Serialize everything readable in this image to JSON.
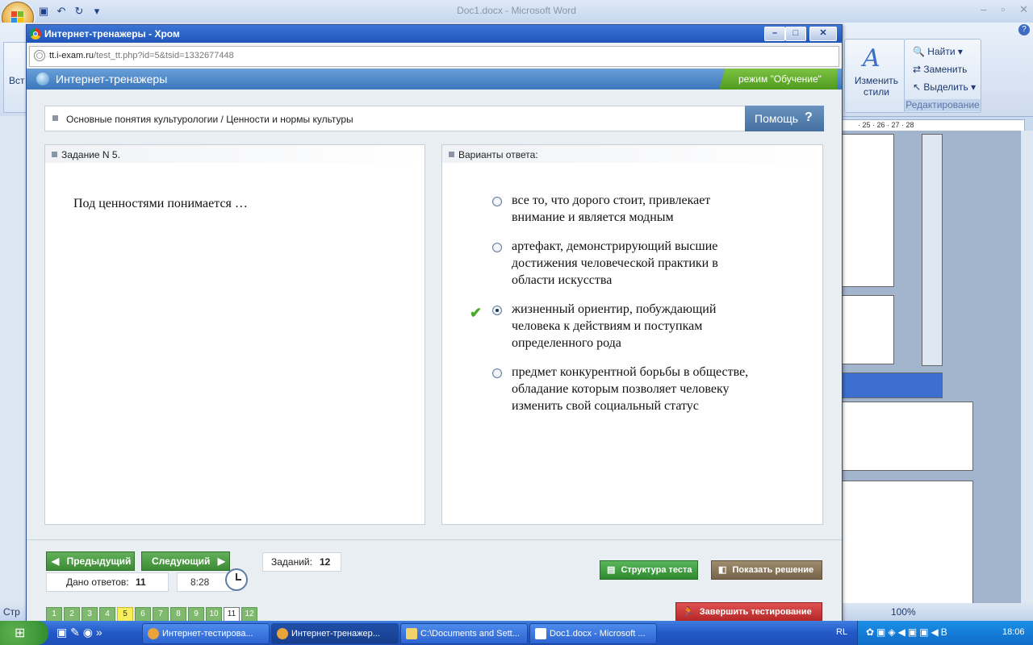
{
  "word": {
    "window_title": "Doc1.docx - Microsoft Word",
    "ribbon_left_label": "Вст",
    "styles_label": "Изменить стили",
    "editing": {
      "find": "Найти",
      "replace": "Заменить",
      "select": "Выделить",
      "group_label": "Редактирование"
    },
    "ruler": "· 25 · 26 · 27 · 28",
    "zoom": "100%",
    "status_left": "Стр"
  },
  "chrome": {
    "title": "Интернет-тренажеры - Хром",
    "url_host": "tt.i-exam.ru",
    "url_path": "/test_tt.php?id=5&tsid=1332677448"
  },
  "app": {
    "title": "Интернет-тренажеры",
    "mode": "режим \"Обучение\"",
    "topic": "Основные понятия культурологии / Ценности и нормы культуры",
    "help": "Помощь",
    "help_icon": "?",
    "task_header": "Задание N 5.",
    "question": "Под ценностями понимается …",
    "answers_header": "Варианты ответа:",
    "options": [
      {
        "text": "все то, что дорого стоит, привлекает внимание и является модным",
        "selected": false
      },
      {
        "text": "артефакт, демонстрирующий высшие достижения человеческой практики в области искусства",
        "selected": false
      },
      {
        "text": "жизненный ориентир, побуждающий человека к действиям и поступкам определенного рода",
        "selected": true
      },
      {
        "text": "предмет конкурентной борьбы в обществе, обладание которым позволяет человеку изменить свой социальный статус",
        "selected": false
      }
    ],
    "prev": "Предыдущий",
    "next": "Следующий",
    "tasks_label": "Заданий:",
    "tasks_count": "12",
    "answered_label": "Дано ответов:",
    "answered_count": "11",
    "time": "8:28",
    "pages": [
      "1",
      "2",
      "3",
      "4",
      "5",
      "6",
      "7",
      "8",
      "9",
      "10",
      "11",
      "12"
    ],
    "current_page": "5",
    "struct_btn": "Структура теста",
    "solution_btn": "Показать решение",
    "finish_btn": "Завершить тестирование"
  },
  "taskbar": {
    "tasks": [
      {
        "label": "Интернет-тестирова...",
        "icon": "chrome-icon"
      },
      {
        "label": "Интернет-тренажер...",
        "icon": "chrome-icon"
      },
      {
        "label": "C:\\Documents and Sett...",
        "icon": "folder-icon"
      },
      {
        "label": "Doc1.docx - Microsoft ...",
        "icon": "word-icon"
      }
    ],
    "lang": "RL",
    "time": "18:06"
  }
}
